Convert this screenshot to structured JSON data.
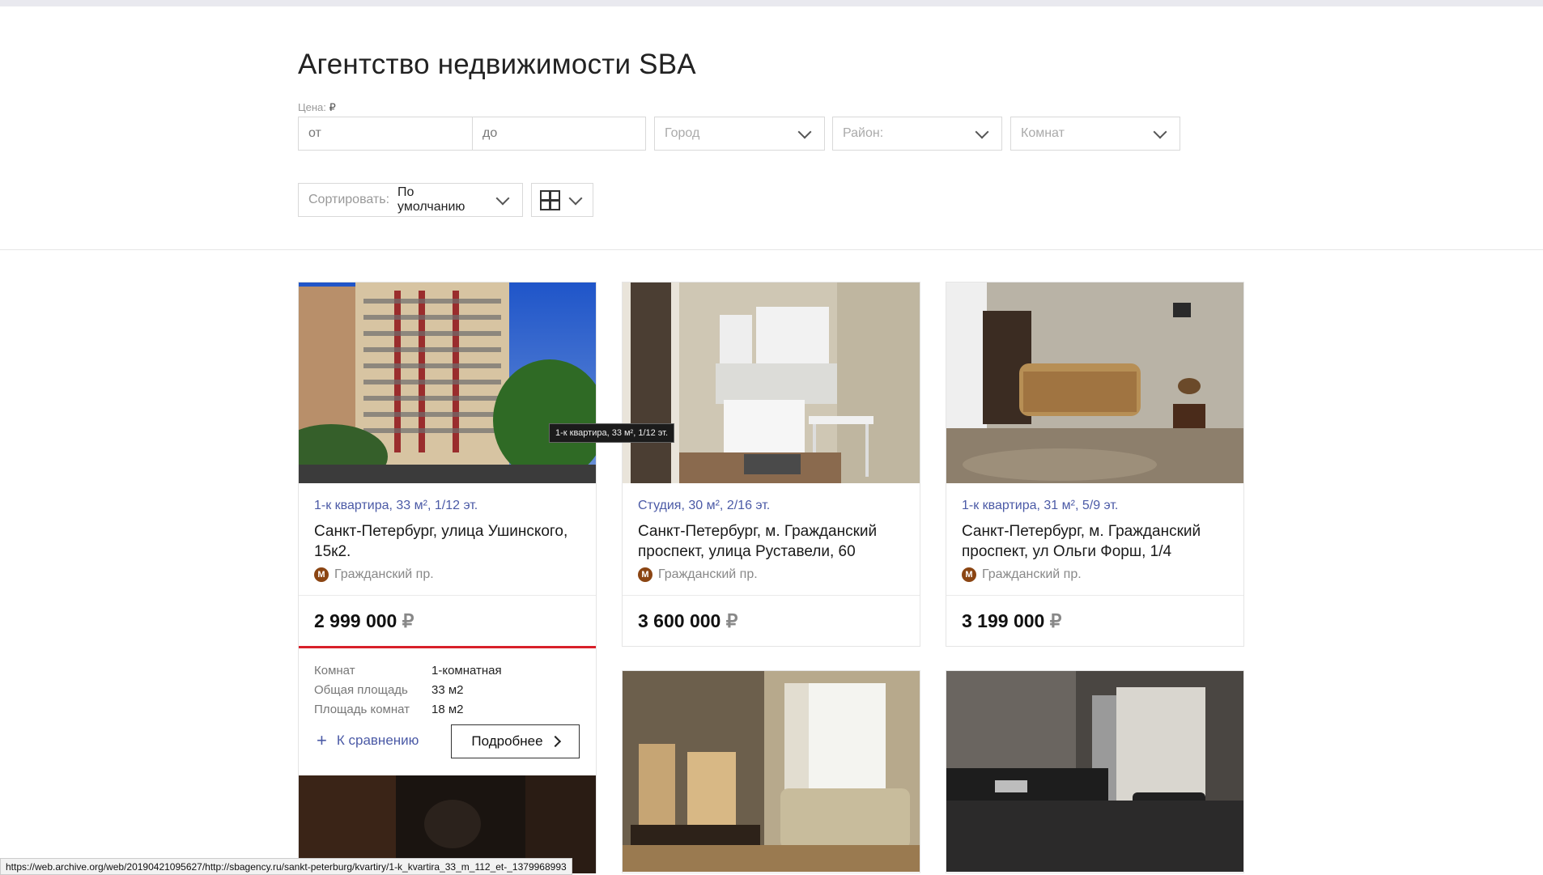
{
  "header": {
    "title": "Агентство недвижимости SBA"
  },
  "filters": {
    "price_label": "Цена:",
    "currency": "₽",
    "price_from_placeholder": "от",
    "price_to_placeholder": "до",
    "city_placeholder": "Город",
    "district_placeholder": "Район:",
    "rooms_placeholder": "Комнат"
  },
  "sort": {
    "label": "Сортировать:",
    "value": "По умолчанию"
  },
  "cards": [
    {
      "title": "1-к квартира, 33 м², 1/12 эт.",
      "address": "Санкт-Петербург, улица Ушинского, 15к2.",
      "metro": "Гражданский пр.",
      "price": "2 999 000",
      "details": [
        {
          "label": "Комнат",
          "value": "1-комнатная"
        },
        {
          "label": "Общая площадь",
          "value": "33 м2"
        },
        {
          "label": "Площадь комнат",
          "value": "18 м2"
        }
      ],
      "compare_label": "К сравнению",
      "more_label": "Подробнее"
    },
    {
      "title": "Студия, 30 м², 2/16 эт.",
      "address": "Санкт-Петербург, м. Гражданский проспект, улица Руставели, 60",
      "metro": "Гражданский пр.",
      "price": "3 600 000"
    },
    {
      "title": "1-к квартира, 31 м², 5/9 эт.",
      "address": "Санкт-Петербург, м. Гражданский проспект, ул Ольги Форш, 1/4",
      "metro": "Гражданский пр.",
      "price": "3 199 000"
    }
  ],
  "metro_badge": "М",
  "tooltip": "1-к квартира, 33 м², 1/12 эт.",
  "status_url": "https://web.archive.org/web/20190421095627/http://sbagency.ru/sankt-peterburg/kvartiry/1-k_kvartira_33_m_112_et-_1379968993",
  "colors": {
    "accent_blue": "#4b5aa6",
    "accent_red": "#d8202a",
    "metro": "#8b4513"
  }
}
